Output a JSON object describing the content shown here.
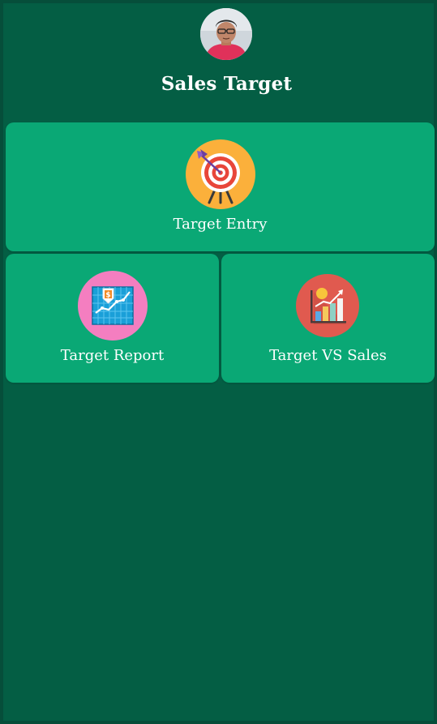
{
  "header": {
    "title": "Sales Target",
    "avatar_icon": "user-avatar-photo"
  },
  "menu": {
    "items": [
      {
        "label": "Target Entry",
        "icon": "target-arrow-icon",
        "icon_bg": "#fbb03b"
      },
      {
        "label": "Target Report",
        "icon": "finance-report-chart-icon",
        "icon_bg": "#f47ec0"
      },
      {
        "label": "Target VS Sales",
        "icon": "bar-chart-growth-icon",
        "icon_bg": "#e05a4f"
      }
    ]
  },
  "colors": {
    "background": "#045e44",
    "card": "#0aa875",
    "text": "#ffffff"
  }
}
